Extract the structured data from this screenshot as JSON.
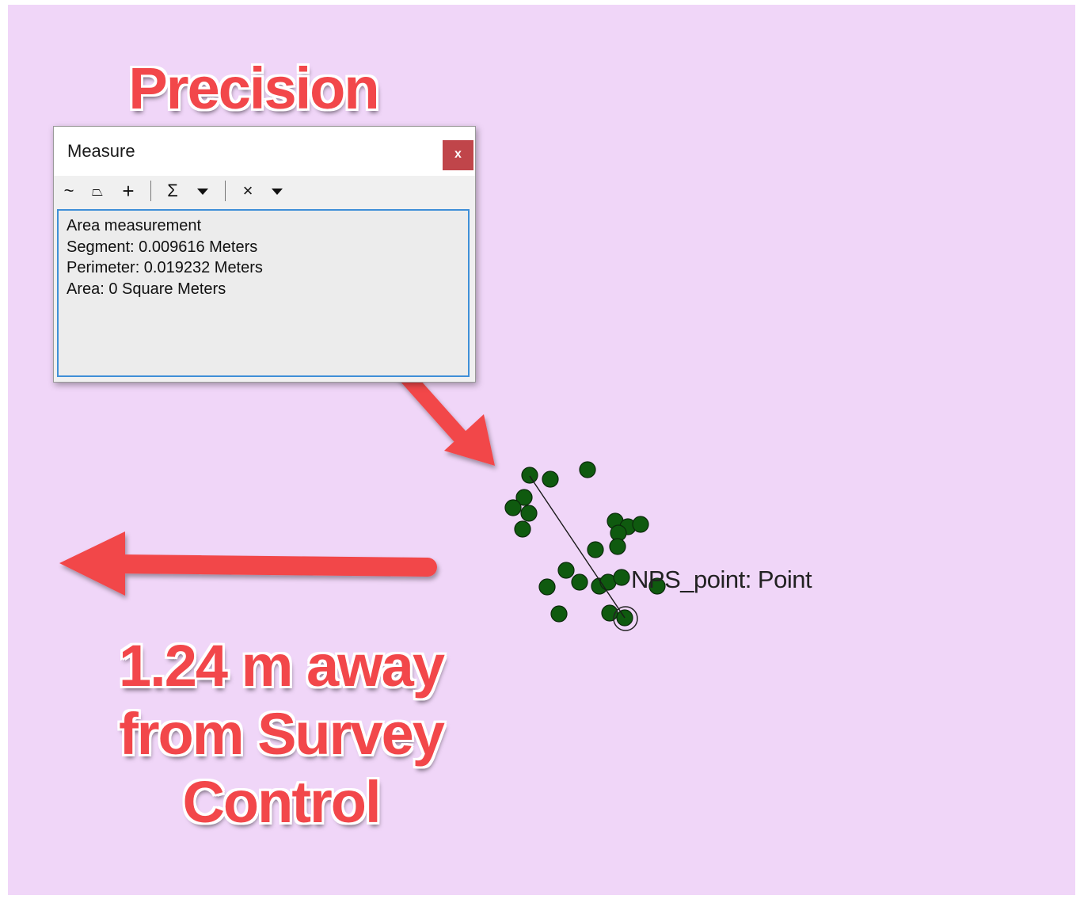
{
  "annotations": {
    "precision_title": "Precision",
    "distance_callout": [
      "1.24 m away",
      "from Survey",
      "Control"
    ],
    "arrow_color": "#f2474a"
  },
  "measure_window": {
    "title": "Measure",
    "close_label": "x",
    "toolbar": {
      "measure_line_icon": "~",
      "measure_area_icon": "⏢",
      "measure_feature_icon": "+",
      "sum_icon": "Σ",
      "clear_icon": "×"
    },
    "results": [
      "Area measurement",
      "Segment: 0.009616 Meters",
      "Perimeter: 0.019232 Meters",
      "Area: 0 Square Meters"
    ]
  },
  "map": {
    "background_color": "#f0d6f8",
    "point_color": "#0f5a0f",
    "feature_label": "NPS_point: Point"
  }
}
